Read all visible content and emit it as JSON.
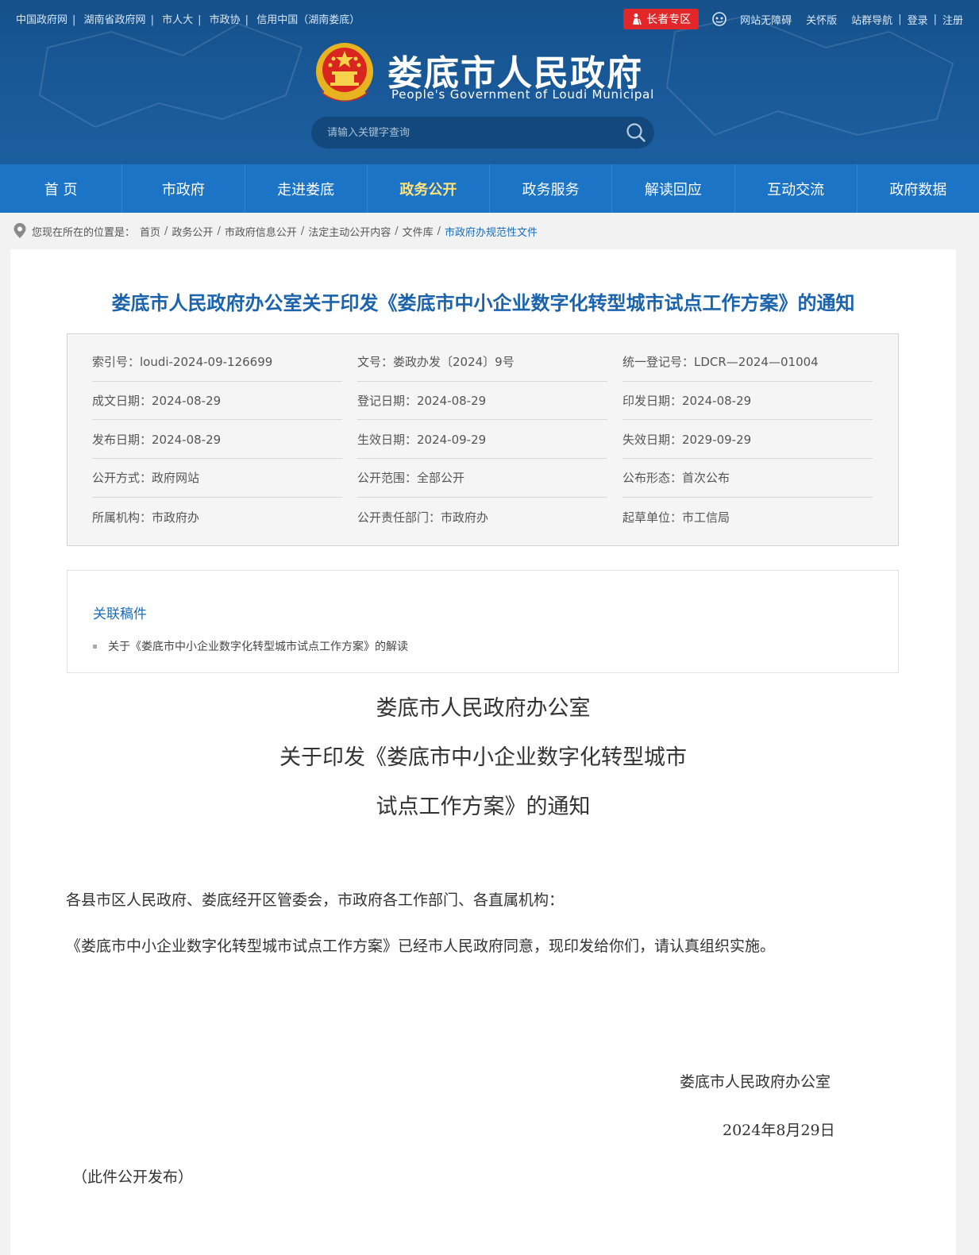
{
  "top_links": [
    "中国政府网",
    "湖南省政府网",
    "市人大",
    "市政协",
    "信用中国（湖南娄底）"
  ],
  "top_right": {
    "elder_label": "长者专区",
    "links_a": [
      "网站无障碍",
      "关怀版",
      "站群导航"
    ],
    "links_b": [
      "登录",
      "注册"
    ]
  },
  "site": {
    "title": "娄底市人民政府",
    "subtitle": "People's Government  of Loudi Municipal"
  },
  "search": {
    "placeholder": "请输入关键字查询"
  },
  "nav": [
    "首 页",
    "市政府",
    "走进娄底",
    "政务公开",
    "政务服务",
    "解读回应",
    "互动交流",
    "政府数据"
  ],
  "nav_active_index": 3,
  "breadcrumb": {
    "label": "您现在所在的位置是：",
    "items": [
      "首页",
      "政务公开",
      "市政府信息公开",
      "法定主动公开内容",
      "文件库",
      "市政府办规范性文件"
    ]
  },
  "doc_title": "娄底市人民政府办公室关于印发《娄底市中小企业数字化转型城市试点工作方案》的通知",
  "meta": [
    [
      "索引号：loudi-2024-09-126699",
      "文号：娄政办发〔2024〕9号",
      "统一登记号：LDCR—2024—01004"
    ],
    [
      "成文日期：2024-08-29",
      "登记日期：2024-08-29",
      "印发日期：2024-08-29"
    ],
    [
      "发布日期：2024-08-29",
      "生效日期：2024-09-29",
      "失效日期：2029-09-29"
    ],
    [
      "公开方式：政府网站",
      "公开范围：全部公开",
      "公布形态：首次公布"
    ],
    [
      "所属机构：市政府办",
      "公开责任部门：市政府办",
      "起草单位：市工信局"
    ]
  ],
  "related": {
    "title": "关联稿件",
    "items": [
      "关于《娄底市中小企业数字化转型城市试点工作方案》的解读"
    ]
  },
  "body": {
    "heading": [
      "娄底市人民政府办公室",
      "关于印发《娄底市中小企业数字化转型城市",
      "试点工作方案》的通知"
    ],
    "salutation": "各县市区人民政府、娄底经开区管委会，市政府各工作部门、各直属机构：",
    "paragraph": "《娄底市中小企业数字化转型城市试点工作方案》已经市人民政府同意，现印发给你们，请认真组织实施。",
    "signature": "娄底市人民政府办公室",
    "date": "2024年8月29日",
    "note": "（此件公开发布）"
  },
  "colors": {
    "header_blue": "#1a5a9a",
    "nav_blue": "#1b74c5",
    "title_blue": "#1b63ad",
    "active_nav": "#ffe27a",
    "elder_red": "#e2272b"
  }
}
